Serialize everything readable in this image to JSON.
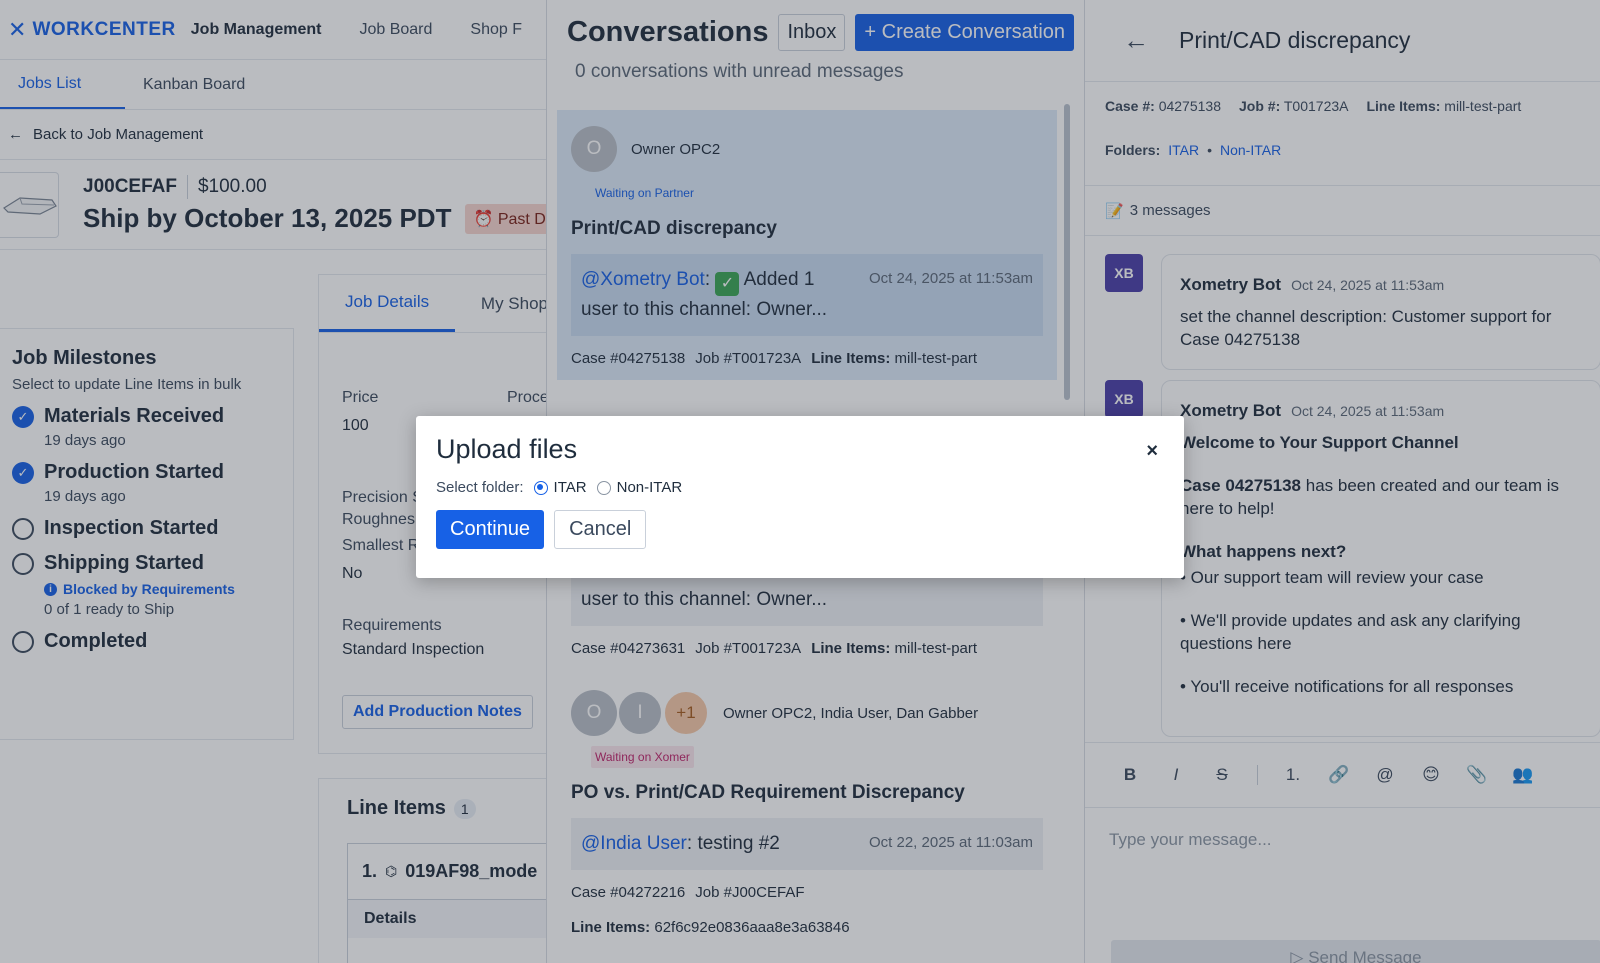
{
  "app": {
    "brand": "WORKCENTER",
    "nav": [
      "Job Management",
      "Job Board",
      "Shop F"
    ],
    "subtabs": [
      "Jobs List",
      "Kanban Board"
    ],
    "back_link": "Back to Job Management",
    "job": {
      "id": "J00CEFAF",
      "price": "$100.00",
      "ship_by": "Ship by October 13, 2025 PDT",
      "past_due": "Past Du"
    },
    "milestones": {
      "title": "Job Milestones",
      "subtitle": "Select to update Line Items in bulk",
      "items": [
        {
          "label": "Materials Received",
          "meta": "19 days ago",
          "done": true
        },
        {
          "label": "Production Started",
          "meta": "19 days ago",
          "done": true
        },
        {
          "label": "Inspection Started",
          "done": false
        },
        {
          "label": "Shipping Started",
          "blocked": "Blocked by Requirements",
          "meta": "0 of 1 ready to Ship",
          "done": false
        },
        {
          "label": "Completed",
          "done": false
        }
      ]
    },
    "details": {
      "tabs": [
        "Job Details",
        "My Shop N"
      ],
      "price_label": "Price",
      "price_value": "100",
      "process_label": "Proce",
      "precision_label": "Precision S",
      "roughness_label": "Roughnes",
      "smallest_label": "Smallest R",
      "smallest_value": "No",
      "requirements_label": "Requirements",
      "requirements_value": "Standard Inspection",
      "production_notes_button": "Add Production Notes"
    },
    "line_items": {
      "title": "Line Items",
      "count": "1",
      "row_number": "1.",
      "row_name": "019AF98_mode",
      "details_label": "Details"
    }
  },
  "conversations": {
    "title": "Conversations",
    "inbox_button": "Inbox",
    "create_button": "+ Create Conversation",
    "unread": "0 conversations with unread messages",
    "items": [
      {
        "avatar": "O",
        "owner": "Owner OPC2",
        "status": "Waiting on Partner",
        "subject": "Print/CAD discrepancy",
        "mention": "@Xometry Bot",
        "preview_line1": "Added 1",
        "preview_line2": "user to this channel: Owner...",
        "date": "Oct 24, 2025 at 11:53am",
        "case": "Case #04275138",
        "job": "Job #T001723A",
        "line_items_label": "Line Items:",
        "line_items": "mill-test-part"
      },
      {
        "preview_line2": "user to this channel: Owner...",
        "case": "Case #04273631",
        "job": "Job #T001723A",
        "line_items_label": "Line Items:",
        "line_items": "mill-test-part"
      },
      {
        "avatars": [
          "O",
          "I",
          "+1"
        ],
        "owner": "Owner OPC2, India User, Dan Gabber",
        "status": "Waiting on Xomer",
        "subject": "PO vs. Print/CAD Requirement Discrepancy",
        "mention": "@India User",
        "preview_text": ": testing #2",
        "date": "Oct 22, 2025 at 11:03am",
        "case": "Case #04272216",
        "job": "Job #J00CEFAF",
        "line_items_label": "Line Items:",
        "line_items": "62f6c92e0836aaa8e3a63846"
      }
    ]
  },
  "detail": {
    "title": "Print/CAD discrepancy",
    "case_label": "Case #:",
    "case_value": "04275138",
    "job_label": "Job #:",
    "job_value": "T001723A",
    "line_items_label": "Line Items:",
    "line_items_value": "mill-test-part",
    "folders_label": "Folders:",
    "folder_1": "ITAR",
    "folder_bullet": "•",
    "folder_2": "Non-ITAR",
    "message_count": "3 messages",
    "messages": [
      {
        "avatar": "XB",
        "sender": "Xometry Bot",
        "time": "Oct 24, 2025 at 11:53am",
        "text": "set the channel description: Customer support for Case 04275138"
      },
      {
        "avatar": "XB",
        "sender": "Xometry Bot",
        "time": "Oct 24, 2025 at 11:53am",
        "heading": "Welcome to Your Support Channel",
        "case_bold": "Case 04275138",
        "case_rest": " has been created and our team is here to help!",
        "next_heading": "What happens next?",
        "bullet_1": "• Our support team will review your case",
        "bullet_2": "• We'll provide updates and ask any clarifying questions here",
        "bullet_3": "• You'll receive notifications for all responses"
      }
    ],
    "toolbar": [
      "B",
      "I",
      "S",
      "1.",
      "🔗",
      "@",
      "😊",
      "📎",
      "👥"
    ],
    "composer_placeholder": "Type your message...",
    "send_button": "▷ Send Message"
  },
  "modal": {
    "title": "Upload files",
    "close": "×",
    "folder_label": "Select folder:",
    "options": [
      "ITAR",
      "Non-ITAR"
    ],
    "selected": "ITAR",
    "continue_button": "Continue",
    "cancel_button": "Cancel"
  },
  "colors": {
    "accent": "#1761e6",
    "selected_card": "#dce9f8",
    "bot_avatar": "#4a3fa8",
    "past_due": "#f6d4cf",
    "waiting_on_xomer": "#c0246b"
  }
}
